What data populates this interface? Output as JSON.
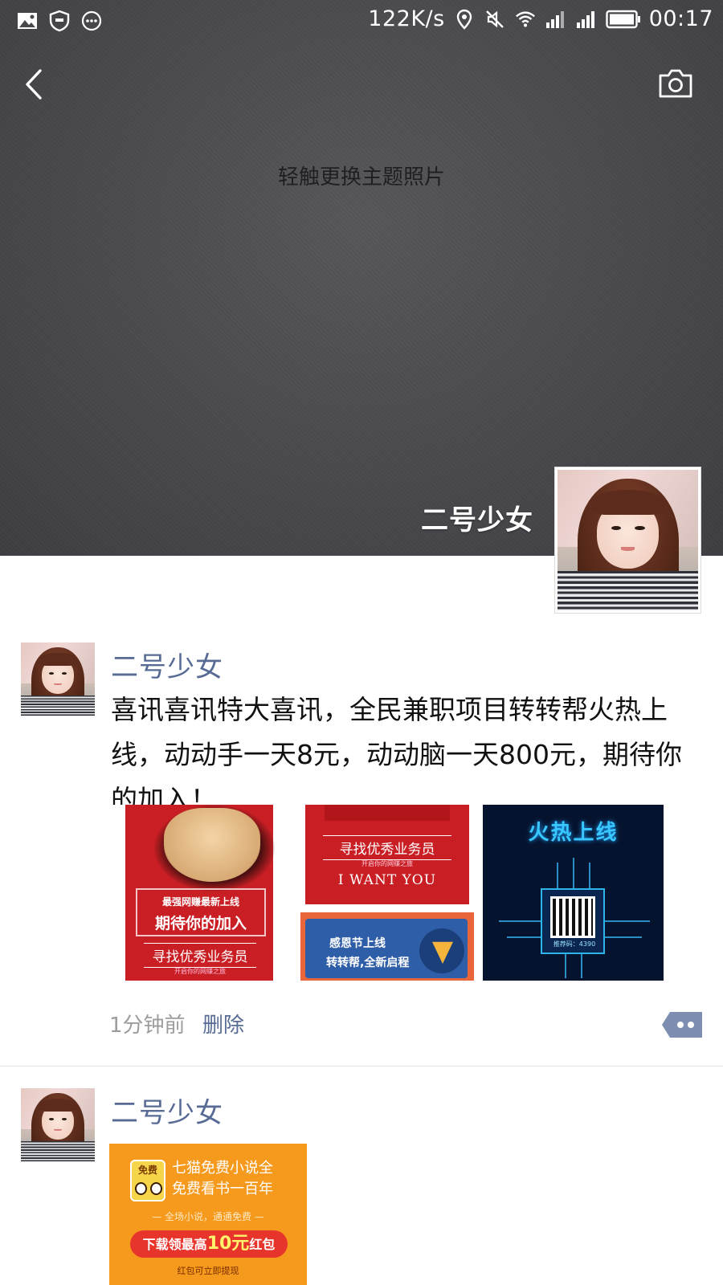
{
  "status_bar": {
    "speed": "122K/s",
    "time": "00:17",
    "left_icons": [
      "image-icon",
      "shield-icon",
      "more-dots-icon"
    ],
    "right_icons": [
      "location-icon",
      "mute-icon",
      "wifi-icon",
      "signal-icon",
      "signal-icon",
      "battery-icon"
    ]
  },
  "header": {
    "back_icon": "chevron-left-icon",
    "camera_icon": "camera-icon",
    "cover_hint": "轻触更换主题照片",
    "user_name": "二号少女"
  },
  "posts": [
    {
      "author": "二号少女",
      "text": "喜讯喜讯特大喜讯，全民兼职项目转转帮火热上线，动动手一天8元，动动脑一天800元，期待你的加入！",
      "images": [
        {
          "banner_small": "最强网赚最新上线",
          "banner_big": "期待你的加入",
          "tag": "寻找优秀业务员",
          "sub": "开启你的网赚之旅"
        },
        {
          "tag": "寻找优秀业务员",
          "sub": "开启你的网赚之旅",
          "english": "I WANT YOU",
          "line1": "感恩节上线",
          "line2": "转转帮,全新启程"
        },
        {
          "title": "火热上线",
          "code": "推荐码：4390"
        }
      ],
      "time": "1分钟前",
      "delete_label": "删除",
      "comment_icon": "comment-dots-icon"
    },
    {
      "author": "二号少女",
      "ad": {
        "logo_text": "免费",
        "line1": "七猫免费小说全",
        "line2": "免费看书一百年",
        "line3": "— 全场小说，通通免费 —",
        "cta_prefix": "下载领最高",
        "cta_amount": "10元",
        "cta_suffix": "红包",
        "note": "红包可立即提现"
      }
    }
  ],
  "colors": {
    "cover_bg": "#4a494d",
    "link_blue": "#576b95",
    "meta_gray": "#9c9c9c"
  }
}
